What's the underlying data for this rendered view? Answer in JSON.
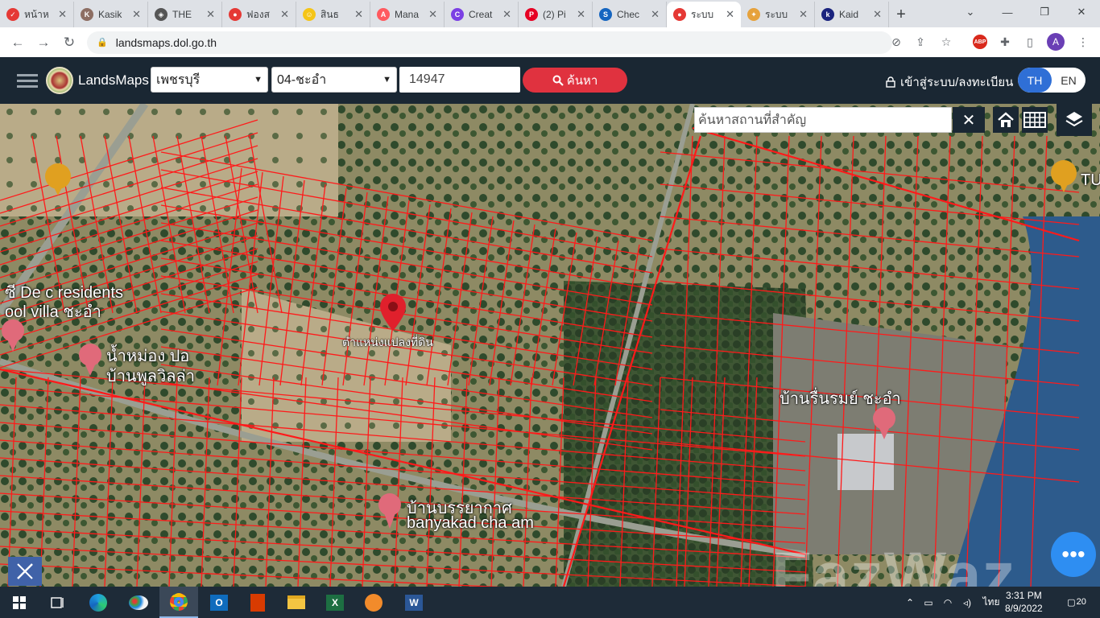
{
  "browser": {
    "tabs": [
      {
        "title": "หน้าห",
        "fav_color": "#e53935",
        "fav_text": "✓"
      },
      {
        "title": "Kasik",
        "fav_color": "#8d6e63",
        "fav_text": "K"
      },
      {
        "title": "THE",
        "fav_color": "#555555",
        "fav_text": "◈"
      },
      {
        "title": "ฟองส",
        "fav_color": "#e53935",
        "fav_text": "●"
      },
      {
        "title": "สินธ",
        "fav_color": "#f5c518",
        "fav_text": "☺"
      },
      {
        "title": "Mana",
        "fav_color": "#ff5a5f",
        "fav_text": "A"
      },
      {
        "title": "Creat",
        "fav_color": "#7b3fe4",
        "fav_text": "C"
      },
      {
        "title": "(2) Pi",
        "fav_color": "#e60023",
        "fav_text": "P"
      },
      {
        "title": "Chec",
        "fav_color": "#1565c0",
        "fav_text": "S"
      },
      {
        "title": "ระบบ",
        "fav_color": "#e53935",
        "fav_text": "●"
      },
      {
        "title": "ระบบ",
        "fav_color": "#e6a23c",
        "fav_text": "✦"
      },
      {
        "title": "Kaid",
        "fav_color": "#1a237e",
        "fav_text": "k"
      }
    ],
    "url": "landsmaps.dol.go.th",
    "profile_initial": "A",
    "abp_label": "ABP"
  },
  "app": {
    "brand": "LandsMaps",
    "province": "เพชรบุรี",
    "district": "04-ชะอำ",
    "parcel_number": "14947",
    "search_label": "ค้นหา",
    "login_label": "เข้าสู่ระบบ/ลงทะเบียน",
    "lang_th": "TH",
    "lang_en": "EN"
  },
  "map": {
    "search_placeholder": "ค้นหาสถานที่สำคัญ",
    "clear_label": "✕",
    "pin_label": "ตำแหน่งแปลงที่ดิน",
    "place_labels": [
      {
        "text": "ซี De c residents"
      },
      {
        "text": "ool villa ชะอำ"
      },
      {
        "text": "น้ำหม่อง ปอ"
      },
      {
        "text": "บ้านพูลวิลล่า"
      },
      {
        "text": "บ้านรื่นรมย์ ชะอำ"
      },
      {
        "text": "บ้านบรรยากาศ"
      },
      {
        "text": "banyakad cha am"
      },
      {
        "text": "TU"
      }
    ],
    "watermark": "FazWaz",
    "chat_label": "•••"
  },
  "taskbar": {
    "time": "3:31 PM",
    "date": "8/9/2022",
    "lang": "ไทย",
    "notifications": "20"
  }
}
